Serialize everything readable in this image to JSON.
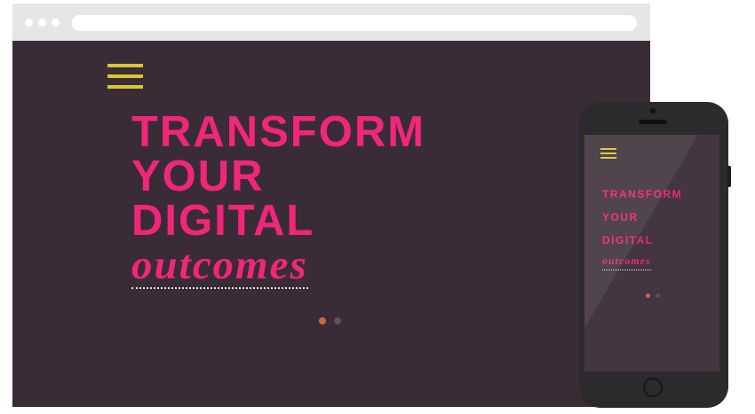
{
  "colors": {
    "background": "#3a2c36",
    "accent_pink": "#f0267a",
    "accent_yellow": "#d8c733",
    "dot_active": "#c96a3e",
    "dot_inactive": "#6e4a4c",
    "browser_chrome": "#e6e6e6",
    "phone_body": "#2b2b2b",
    "phone_screen": "#433640"
  },
  "browser": {
    "window_controls": [
      "close-dot",
      "minimize-dot",
      "maximize-dot"
    ],
    "address_bar_value": ""
  },
  "hero": {
    "line1": "TRANSFORM",
    "line2": "YOUR",
    "line3": "DIGITAL",
    "emphasis": "outcomes"
  },
  "menu_icon": "hamburger-menu-icon",
  "slider": {
    "slide_count": 2,
    "active_index": 0
  },
  "mobile": {
    "hero": {
      "line1": "TRANSFORM",
      "line2": "YOUR",
      "line3": "DIGITAL",
      "emphasis": "outcomes"
    },
    "slider": {
      "slide_count": 2,
      "active_index": 0
    }
  }
}
